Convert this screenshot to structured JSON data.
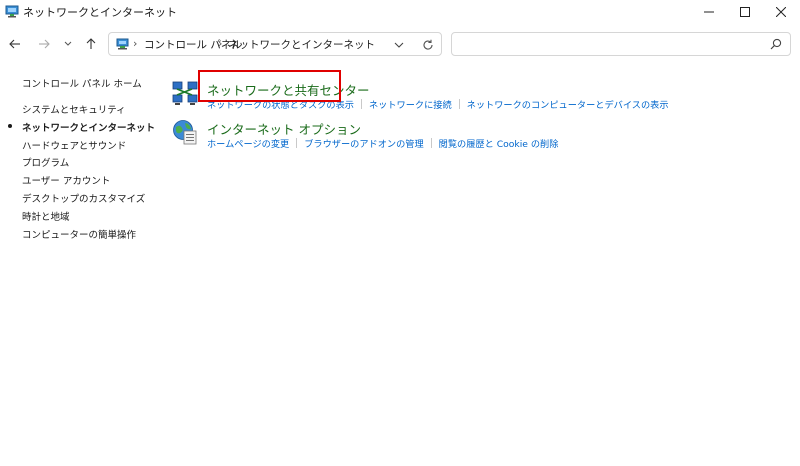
{
  "window": {
    "title": "ネットワークとインターネット"
  },
  "navigation": {
    "breadcrumb": [
      "コントロール パネル",
      "ネットワークとインターネット"
    ],
    "search_placeholder": ""
  },
  "sidebar": {
    "home_label": "コントロール パネル ホーム",
    "items": [
      {
        "label": "システムとセキュリティ",
        "active": false
      },
      {
        "label": "ネットワークとインターネット",
        "active": true
      },
      {
        "label": "ハードウェアとサウンド",
        "active": false
      },
      {
        "label": "プログラム",
        "active": false
      },
      {
        "label": "ユーザー アカウント",
        "active": false
      },
      {
        "label": "デスクトップのカスタマイズ",
        "active": false
      },
      {
        "label": "時計と地域",
        "active": false
      },
      {
        "label": "コンピューターの簡単操作",
        "active": false
      }
    ]
  },
  "categories": [
    {
      "title": "ネットワークと共有センター",
      "icon": "network-sharing-icon",
      "links": [
        "ネットワークの状態とタスクの表示",
        "ネットワークに接続",
        "ネットワークのコンピューターとデバイスの表示"
      ]
    },
    {
      "title": "インターネット オプション",
      "icon": "internet-options-icon",
      "links": [
        "ホームページの変更",
        "ブラウザーのアドオンの管理",
        "閲覧の履歴と Cookie の削除"
      ]
    }
  ],
  "colors": {
    "category_title": "#1a6b1a",
    "link": "#0066cc",
    "highlight": "#e00000"
  }
}
